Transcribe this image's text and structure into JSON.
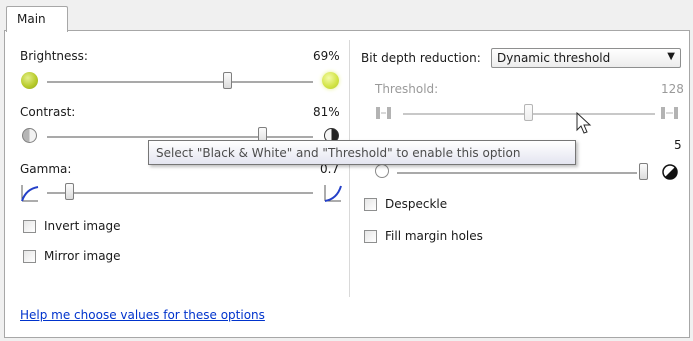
{
  "tabs": {
    "main_label": "Main"
  },
  "brightness": {
    "label": "Brightness:",
    "value_text": "69%",
    "level_fraction": 0.69
  },
  "contrast": {
    "label": "Contrast:",
    "value_text": "81%",
    "level_fraction": 0.81
  },
  "gamma": {
    "label": "Gamma:",
    "value_text": "0.7"
  },
  "checkboxes": {
    "invert_label": "Invert image",
    "mirror_label": "Mirror image",
    "despeckle_label": "Despeckle",
    "fill_holes_label": "Fill margin holes"
  },
  "bit_depth": {
    "label": "Bit depth reduction:",
    "selected": "Dynamic threshold"
  },
  "threshold": {
    "label": "Threshold:",
    "value_text": "128"
  },
  "second_slider": {
    "value_text": "5"
  },
  "tooltip": {
    "text": "Select \"Black & White\" and \"Threshold\" to enable this option"
  },
  "help_link": {
    "text": "Help me choose values for these options"
  },
  "colors": {
    "link": "#0033cc",
    "tooltip_border": "#767676",
    "disabled_text": "#9a9a9a"
  }
}
